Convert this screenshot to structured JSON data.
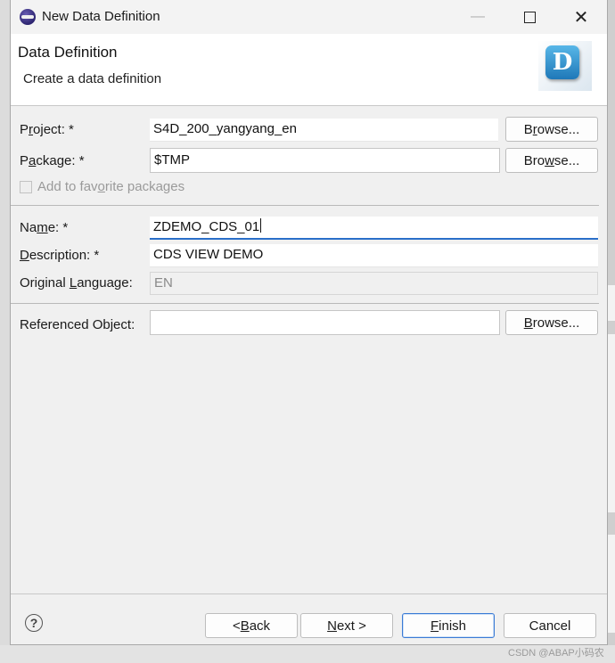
{
  "window": {
    "title": "New Data Definition",
    "minimize_label": "—",
    "close_label": "✕"
  },
  "banner": {
    "title": "Data Definition",
    "subtitle": "Create a data definition",
    "logo_letter": "D"
  },
  "form": {
    "project": {
      "label_pre": "P",
      "label_ul": "r",
      "label_post": "oject: *",
      "value": "S4D_200_yangyang_en"
    },
    "package": {
      "label_pre": "P",
      "label_ul": "a",
      "label_post": "ckage: *",
      "value": "$TMP"
    },
    "favorite": {
      "label_pre": "Add to fav",
      "label_ul": "o",
      "label_post": "rite packages",
      "checked": false
    },
    "name": {
      "label_pre": "Na",
      "label_ul": "m",
      "label_post": "e: *",
      "value": "ZDEMO_CDS_01"
    },
    "description": {
      "label_pre": "",
      "label_ul": "D",
      "label_post": "escription: *",
      "value": "CDS VIEW DEMO"
    },
    "language": {
      "label_pre": "Original ",
      "label_ul": "L",
      "label_post": "anguage:",
      "value": "EN"
    },
    "referenced": {
      "label": "Referenced Object:",
      "value": ""
    },
    "browse": {
      "pre": "B",
      "ul": "r",
      "post": "owse..."
    },
    "browse2": {
      "pre": "Bro",
      "ul": "w",
      "post": "se..."
    },
    "browse3": {
      "pre": "",
      "ul": "B",
      "post": "rowse..."
    }
  },
  "footer": {
    "help_label": "?",
    "back": {
      "pre": "< ",
      "ul": "B",
      "post": "ack"
    },
    "next": {
      "pre": "",
      "ul": "N",
      "post": "ext >"
    },
    "finish": {
      "pre": "",
      "ul": "F",
      "post": "inish"
    },
    "cancel": "Cancel"
  },
  "watermark": "CSDN @ABAP小码农",
  "colors": {
    "focus_underline": "#2a6fc9",
    "default_button_border": "#3a7bd5",
    "logo_blue": "#1f78b8"
  }
}
